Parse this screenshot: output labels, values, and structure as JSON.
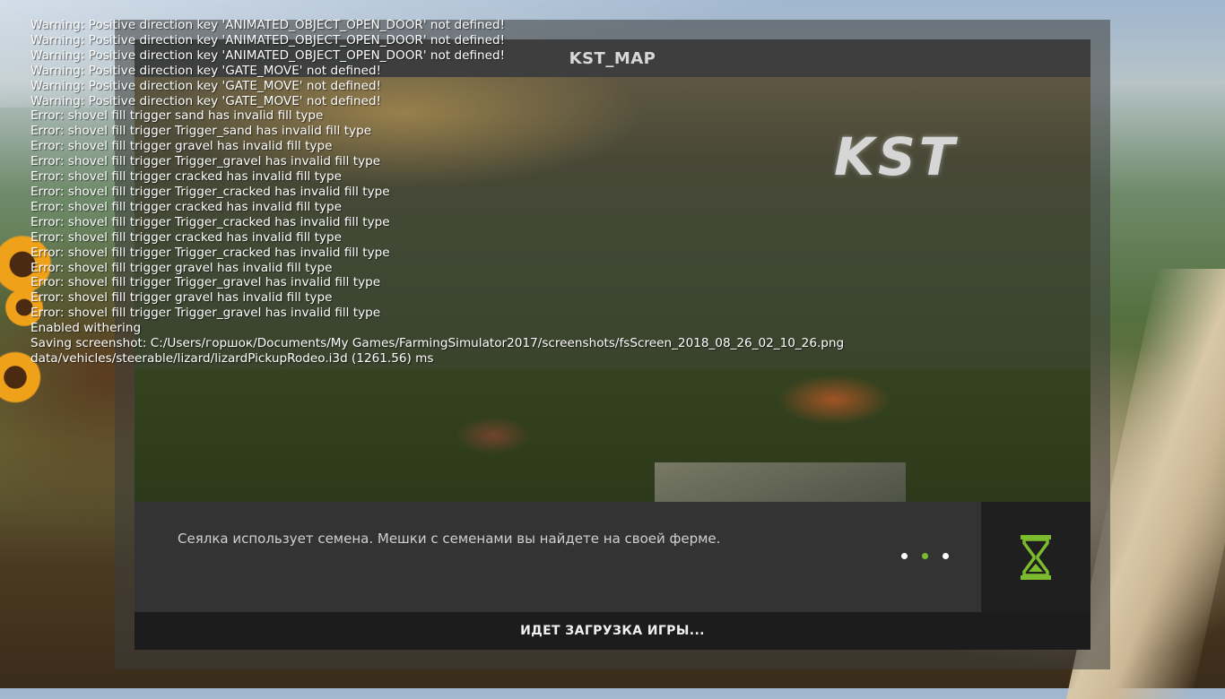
{
  "console": {
    "lines": [
      "Warning: Positive direction key 'ANIMATED_OBJECT_OPEN_DOOR' not defined!",
      "Warning: Positive direction key 'ANIMATED_OBJECT_OPEN_DOOR' not defined!",
      "Warning: Positive direction key 'ANIMATED_OBJECT_OPEN_DOOR' not defined!",
      "Warning: Positive direction key 'GATE_MOVE' not defined!",
      "Warning: Positive direction key 'GATE_MOVE' not defined!",
      "Warning: Positive direction key 'GATE_MOVE' not defined!",
      "Error: shovel fill trigger sand has invalid fill type",
      "Error: shovel fill trigger Trigger_sand has invalid fill type",
      "Error: shovel fill trigger gravel has invalid fill type",
      "Error: shovel fill trigger Trigger_gravel has invalid fill type",
      "Error: shovel fill trigger cracked has invalid fill type",
      "Error: shovel fill trigger Trigger_cracked has invalid fill type",
      "Error: shovel fill trigger cracked has invalid fill type",
      "Error: shovel fill trigger Trigger_cracked has invalid fill type",
      "Error: shovel fill trigger cracked has invalid fill type",
      "Error: shovel fill trigger Trigger_cracked has invalid fill type",
      "Error: shovel fill trigger gravel has invalid fill type",
      "Error: shovel fill trigger Trigger_gravel has invalid fill type",
      "Error: shovel fill trigger gravel has invalid fill type",
      "Error: shovel fill trigger Trigger_gravel has invalid fill type",
      "Enabled withering",
      "Saving screenshot: C:/Users/горшок/Documents/My Games/FarmingSimulator2017/screenshots/fsScreen_2018_08_26_02_10_26.png",
      "data/vehicles/steerable/lizard/lizardPickupRodeo.i3d (1261.56) ms"
    ]
  },
  "loading_screen": {
    "map_title": "KST_MAP",
    "logo_text": "KST",
    "tip_text": "Сеялка использует семена. Мешки с семенами вы найдете на своей ферме.",
    "tip_pager": {
      "count": 3,
      "active_index": 1
    },
    "status_text": "ИДЕТ ЗАГРУЗКА ИГРЫ...",
    "status_icon": "hourglass-icon"
  },
  "colors": {
    "accent": "#7dbb2e",
    "panel_dark": "#1f1f1f",
    "panel": "#333333",
    "header": "#3a3a3a"
  }
}
